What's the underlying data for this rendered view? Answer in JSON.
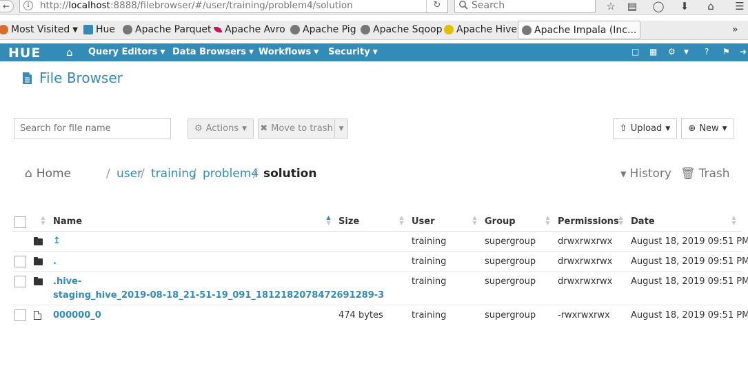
{
  "browser": {
    "url_prefix": "http://",
    "url_host": "localhost",
    "url_rest": ":8888/filebrowser/#/user/training/problem4/solution",
    "search_placeholder": "Search",
    "bookmarks": [
      {
        "label": "Most Visited",
        "icon": "fire-icon"
      },
      {
        "label": "Hue",
        "icon": "hue-icon"
      },
      {
        "label": "Apache Parquet",
        "icon": "globe-icon"
      },
      {
        "label": "Apache Avro",
        "icon": "feather-icon"
      },
      {
        "label": "Apache Pig",
        "icon": "globe-icon"
      },
      {
        "label": "Apache Sqoop",
        "icon": "globe-icon"
      },
      {
        "label": "Apache Hive",
        "icon": "hive-icon"
      },
      {
        "label": "Apache Impala (Inc...",
        "icon": "globe-icon"
      }
    ]
  },
  "nav": {
    "logo": "HUE",
    "items": [
      "Query Editors",
      "Data Browsers",
      "Workflows",
      "Security"
    ]
  },
  "page": {
    "title": "File Browser",
    "search_placeholder": "Search for file name",
    "actions_label": "Actions",
    "move_to_trash_label": "Move to trash",
    "upload_label": "Upload",
    "new_label": "New"
  },
  "breadcrumb": {
    "home": "Home",
    "parts": [
      "user",
      "training",
      "problem4"
    ],
    "current": "solution",
    "history": "History",
    "trash": "Trash"
  },
  "table": {
    "columns": [
      "Name",
      "Size",
      "User",
      "Group",
      "Permissions",
      "Date"
    ],
    "rows": [
      {
        "type": "folder",
        "name": "↥",
        "size": "",
        "user": "training",
        "group": "supergroup",
        "perms": "drwxrwxrwx",
        "date": "August 18, 2019 09:51 PM",
        "checkbox": false
      },
      {
        "type": "folder",
        "name": ".",
        "size": "",
        "user": "training",
        "group": "supergroup",
        "perms": "drwxrwxrwx",
        "date": "August 18, 2019 09:51 PM",
        "checkbox": true
      },
      {
        "type": "folder",
        "name": ".hive-",
        "name2": "staging_hive_2019-08-18_21-51-19_091_1812182078472691289-3",
        "size": "",
        "user": "training",
        "group": "supergroup",
        "perms": "drwxrwxrwx",
        "date": "August 18, 2019 09:51 PM",
        "checkbox": true
      },
      {
        "type": "file",
        "name": "000000_0",
        "size": "474 bytes",
        "user": "training",
        "group": "supergroup",
        "perms": "-rwxrwxrwx",
        "date": "August 18, 2019 09:51 PM",
        "checkbox": true
      }
    ]
  },
  "colors": {
    "accent": "#338bb8",
    "nav_bg": "#338bb8"
  }
}
